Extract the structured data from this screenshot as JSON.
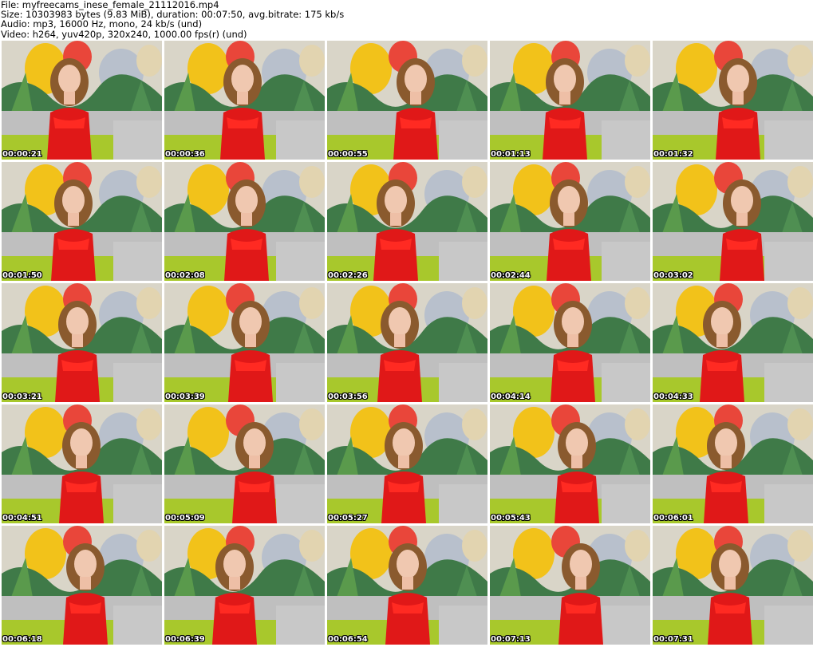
{
  "header": {
    "file_line": "File: myfreecams_inese_female_21112016.mp4",
    "size_line": "Size: 10303983 bytes (9.83 MiB), duration: 00:07:50, avg.bitrate: 175 kb/s",
    "audio_line": "Audio: mp3, 16000 Hz, mono, 24 kb/s (und)",
    "video_line": "Video: h264, yuv420p, 320x240, 1000.00 fps(r) (und)"
  },
  "colors": {
    "background": "#ffffff",
    "text": "#000000",
    "stamp_text": "#ffffff",
    "stamp_outline": "#000000"
  },
  "thumbnails": [
    "00:00:21",
    "00:00:36",
    "00:00:55",
    "00:01:13",
    "00:01:32",
    "00:01:50",
    "00:02:08",
    "00:02:26",
    "00:02:44",
    "00:03:02",
    "00:03:21",
    "00:03:39",
    "00:03:56",
    "00:04:14",
    "00:04:33",
    "00:04:51",
    "00:05:09",
    "00:05:27",
    "00:05:43",
    "00:06:01",
    "00:06:18",
    "00:06:39",
    "00:06:54",
    "00:07:13",
    "00:07:31"
  ]
}
